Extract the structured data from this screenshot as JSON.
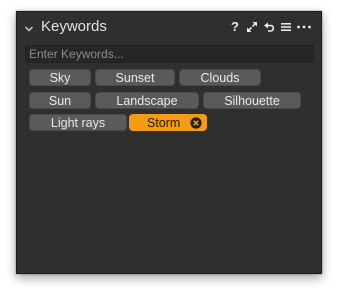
{
  "panel": {
    "title": "Keywords",
    "help_icon": "?",
    "tools": [
      "help-icon",
      "expand-icon",
      "reset-icon",
      "menu-icon",
      "more-icon"
    ]
  },
  "search": {
    "placeholder": "Enter Keywords..."
  },
  "keywords": [
    {
      "label": "Sky",
      "selected": false
    },
    {
      "label": "Sunset",
      "selected": false
    },
    {
      "label": "Clouds",
      "selected": false
    },
    {
      "label": "Sun",
      "selected": false
    },
    {
      "label": "Landscape",
      "selected": false
    },
    {
      "label": "Silhouette",
      "selected": false
    },
    {
      "label": "Light rays",
      "selected": false
    },
    {
      "label": "Storm",
      "selected": true
    }
  ],
  "colors": {
    "panel_bg": "#2f2f2f",
    "tag_bg": "#5a5a5a",
    "selected_bg": "#f39a17"
  }
}
